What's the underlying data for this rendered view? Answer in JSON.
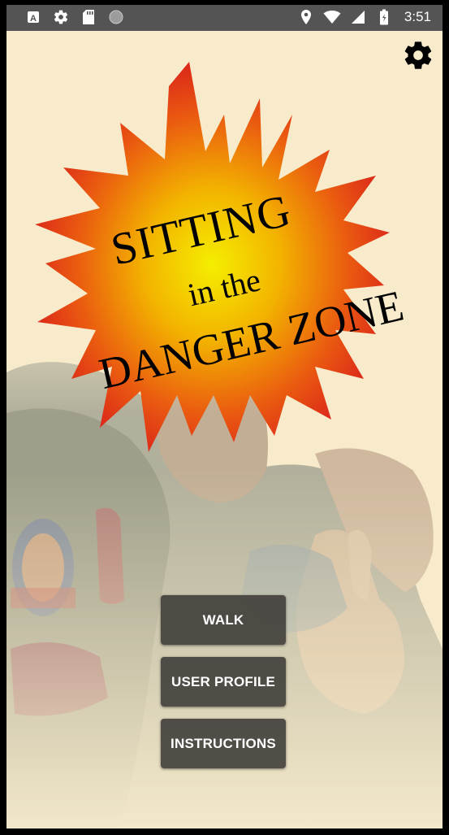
{
  "status_bar": {
    "time": "3:51",
    "left_icons": [
      "text-icon",
      "gear-icon",
      "sd-card-icon",
      "circle-icon"
    ],
    "right_icons": [
      "location-icon",
      "wifi-icon",
      "signal-icon",
      "battery-icon"
    ]
  },
  "logo": {
    "line1": "SITTING",
    "line2": "in the",
    "line3": "DANGER ZONE"
  },
  "buttons": {
    "walk": "WALK",
    "user_profile": "USER PROFILE",
    "instructions": "INSTRUCTIONS"
  },
  "colors": {
    "background": "#f7ebcc",
    "button": "#403d3a",
    "starburst_outer": "#d81c1c",
    "starburst_inner": "#f4ee00"
  }
}
